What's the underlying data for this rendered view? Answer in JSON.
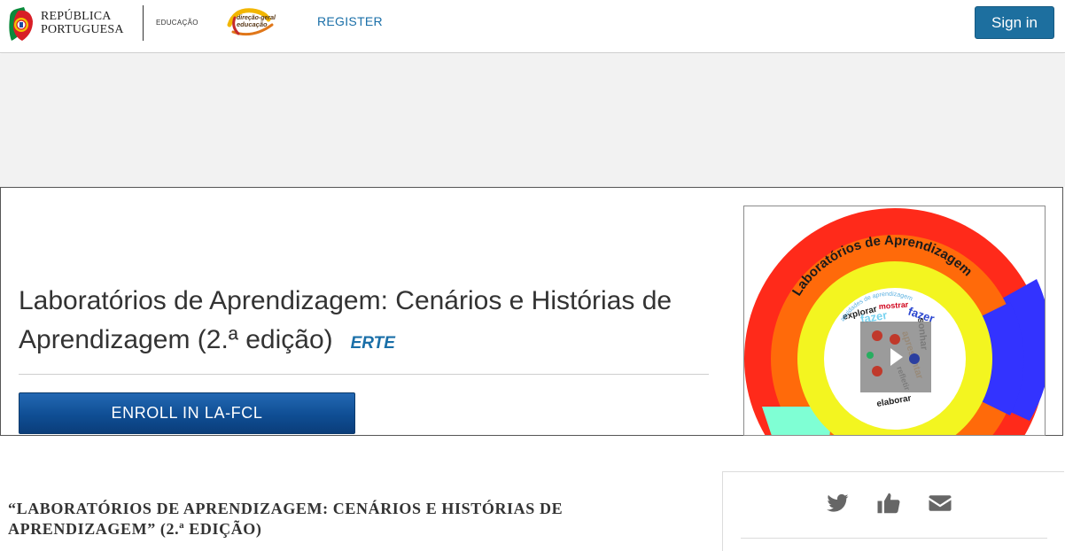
{
  "header": {
    "gov_logo_line1": "REPÚBLICA",
    "gov_logo_line2": "PORTUGUESA",
    "ministry_label": "EDUCAÇÃO",
    "dge_logo_line1": "direção-geral",
    "dge_logo_line2": "educação",
    "register_label": "REGISTER",
    "signin_label": "Sign in"
  },
  "course": {
    "title": "Laboratórios de Aprendizagem: Cenários e Histórias de Aprendizagem (2.ª edição)",
    "org": "ERTE",
    "enroll_label": "ENROLL IN LA-FCL",
    "image": {
      "ring_title": "Laboratórios de Aprendizagem",
      "ring_words": [
        "explorar",
        "mostrar",
        "fazer",
        "apresentar",
        "refletir",
        "sonhar",
        "elaborar",
        "atividades de aprendizagem"
      ],
      "colors": {
        "outer": "#ff2a1a",
        "orange": "#ff6a0a",
        "yellow": "#f3f520",
        "blue": "#3333ff",
        "teal": "#7fffd4"
      }
    }
  },
  "about": {
    "heading": "“LABORATÓRIOS DE APRENDIZAGEM: CENÁRIOS E HISTÓRIAS DE APRENDIZAGEM” (2.ª EDIÇÃO)"
  },
  "share": {
    "icons": [
      "twitter-icon",
      "facebook-like-icon",
      "email-icon"
    ]
  },
  "colors": {
    "accent": "#1d6f9f",
    "enroll": "#0f4e94",
    "link": "#1a6fa8"
  }
}
